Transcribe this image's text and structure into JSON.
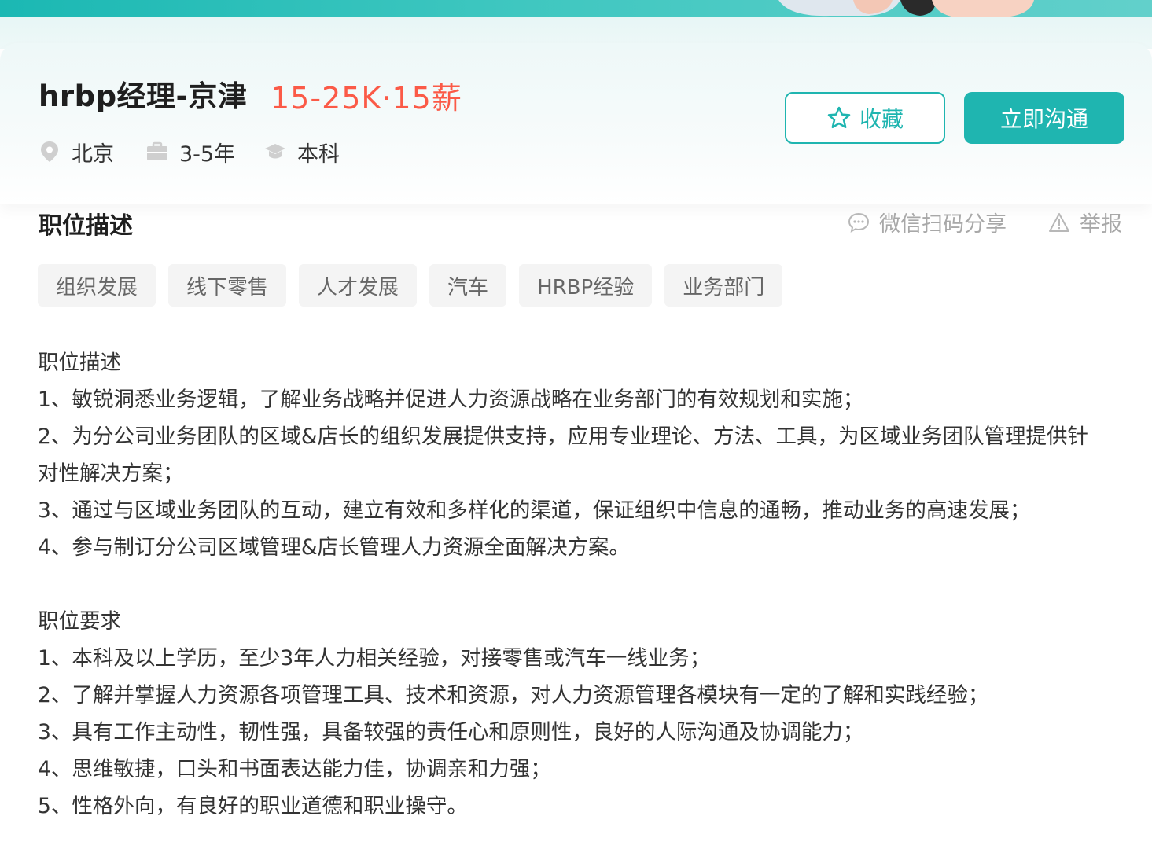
{
  "job": {
    "title": "hrbp经理-京津",
    "salary": "15-25K·15薪",
    "city": "北京",
    "experience": "3-5年",
    "education": "本科"
  },
  "actions": {
    "favorite_label": "收藏",
    "chat_label": "立即沟通"
  },
  "section": {
    "title": "职位描述",
    "share_label": "微信扫码分享",
    "report_label": "举报"
  },
  "tags": [
    "组织发展",
    "线下零售",
    "人才发展",
    "汽车",
    "HRBP经验",
    "业务部门"
  ],
  "description": {
    "duties_heading": "职位描述",
    "duties_line1": "1、敏锐洞悉业务逻辑，了解业务战略并促进人力资源战略在业务部门的有效规划和实施；",
    "duties_line2a": "2、为分公司业务团队的区域&店长的组织发展提供支持，应用专业理论、方法、工具，为区域业务团队管理提供针",
    "duties_line2b": "对性解决方案；",
    "duties_line3": "3、通过与区域业务团队的互动，建立有效和多样化的渠道，保证组织中信息的通畅，推动业务的高速发展；",
    "duties_line4": "4、参与制订分公司区域管理&店长管理人力资源全面解决方案。",
    "requirements_heading": "职位要求",
    "req_line1": "1、本科及以上学历，至少3年人力相关经验，对接零售或汽车一线业务；",
    "req_line2": "2、了解并掌握人力资源各项管理工具、技术和资源，对人力资源管理各模块有一定的了解和实践经验；",
    "req_line3": "3、具有工作主动性，韧性强，具备较强的责任心和原则性，良好的人际沟通及协调能力；",
    "req_line4": "4、思维敏捷，口头和书面表达能力佳，协调亲和力强；",
    "req_line5": "5、性格外向，有良好的职业道德和职业操守。"
  },
  "colors": {
    "accent": "#1fb5b0",
    "salary": "#fb5a47",
    "muted": "#a8a8a8",
    "tag_bg": "#f4f4f4"
  },
  "icons": [
    "location-pin-icon",
    "briefcase-icon",
    "graduation-cap-icon",
    "star-icon",
    "chat-bubble-icon",
    "warning-icon"
  ]
}
